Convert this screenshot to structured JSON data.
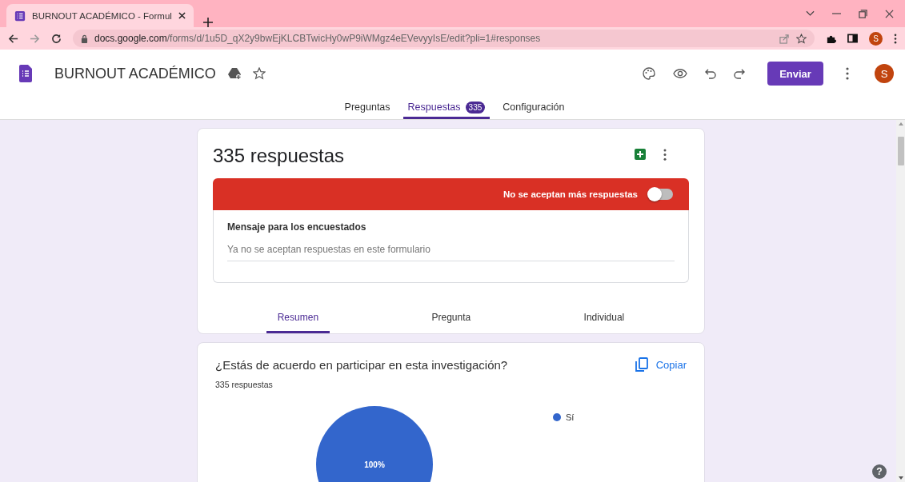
{
  "browser": {
    "tab": {
      "title": "BURNOUT ACADÉMICO - Formul",
      "selected": true
    },
    "url_host": "docs.google.com",
    "url_path": "/forms/d/1u5D_qX2y9bwEjKLCBTwicHy0wP9iWMgz4eEVevyyIsE/edit?pli=1#responses",
    "profile": "S"
  },
  "form": {
    "title": "BURNOUT ACADÉMICO",
    "send_button": "Enviar",
    "avatar": "S",
    "tabs": [
      {
        "label": "Preguntas",
        "selected": false
      },
      {
        "label": "Respuestas",
        "badge": "335",
        "selected": true
      },
      {
        "label": "Configuración",
        "selected": false
      }
    ]
  },
  "responses_card": {
    "title": "335 respuestas",
    "banner": {
      "label": "No se aceptan más respuestas",
      "on": false
    },
    "message": {
      "label": "Mensaje para los encuestados",
      "placeholder": "Ya no se aceptan respuestas en este formulario"
    },
    "tabs": [
      {
        "label": "Resumen",
        "selected": true
      },
      {
        "label": "Pregunta",
        "selected": false
      },
      {
        "label": "Individual",
        "selected": false
      }
    ]
  },
  "questions": [
    {
      "title": "¿Estás de acuerdo en participar en esta investigación?",
      "count": "335 respuestas",
      "copy_button": "Copiar",
      "help_button": "?",
      "chart_data": {
        "type": "pie",
        "categories": [
          "Sí"
        ],
        "series": [
          {
            "color": "#3366cc",
            "values": [
              100
            ]
          }
        ],
        "value_labels": [
          "100%"
        ]
      }
    }
  ]
}
